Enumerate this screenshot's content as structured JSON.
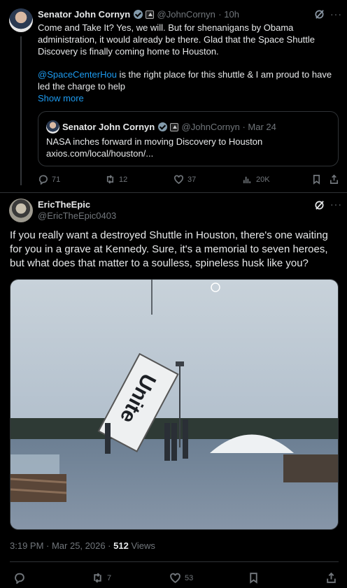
{
  "parent": {
    "name": "Senator John Cornyn",
    "handle": "@JohnCornyn",
    "time": "· 10h",
    "text_p1": "Come and Take It? Yes, we will. But for shenanigans by Obama administration, it would already be there.  Glad that the Space Shuttle Discovery is finally coming home to Houston.",
    "mention": "@SpaceCenterHou",
    "text_p2": " is the right place for this shuttle & I am proud to have led the charge to help",
    "show_more": "Show more",
    "quote": {
      "name": "Senator John Cornyn",
      "handle": "@JohnCornyn · Mar 24",
      "line1": "NASA inches forward in moving Discovery to Houston",
      "line2": "axios.com/local/houston/..."
    },
    "actions": {
      "replies": "71",
      "reposts": "12",
      "likes": "37",
      "views": "20K"
    }
  },
  "reply": {
    "name": "EricTheEpic",
    "handle": "@EricTheEpic0403",
    "text": "If you really want a destroyed Shuttle in Houston, there's one waiting for you in a grave at Kennedy. Sure, it's a memorial to seven heroes, but what does that matter to a soulless, spineless husk like you?",
    "photo_text": "Unite",
    "timestamp": "3:19 PM · Mar 25, 2026 · ",
    "views_count": "512",
    "views_label": " Views",
    "actions": {
      "reposts": "7",
      "likes": "53"
    }
  },
  "icons": [
    "reply-icon",
    "repost-icon",
    "like-icon",
    "views-icon",
    "bookmark-icon",
    "share-icon",
    "grok-icon",
    "more-icon",
    "verified-icon",
    "government-badge-icon"
  ],
  "colors": {
    "accent": "#1d9bf0",
    "muted": "#71767b",
    "border": "#2f3336"
  }
}
